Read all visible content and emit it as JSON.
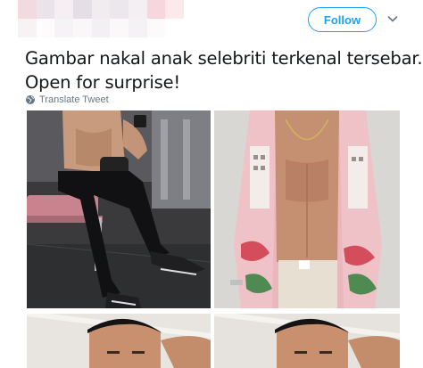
{
  "tweet": {
    "follow_label": "Follow",
    "text_line1": "Gambar nakal anak selebriti terkenal tersebar.",
    "text_line2": "Open for surprise!",
    "translate_label": "Translate Tweet"
  },
  "icons": {
    "chevron": "chevron-down-icon",
    "globe": "globe-icon"
  },
  "colors": {
    "accent": "#1da1f2",
    "text": "#14171a",
    "secondary": "#657786"
  }
}
